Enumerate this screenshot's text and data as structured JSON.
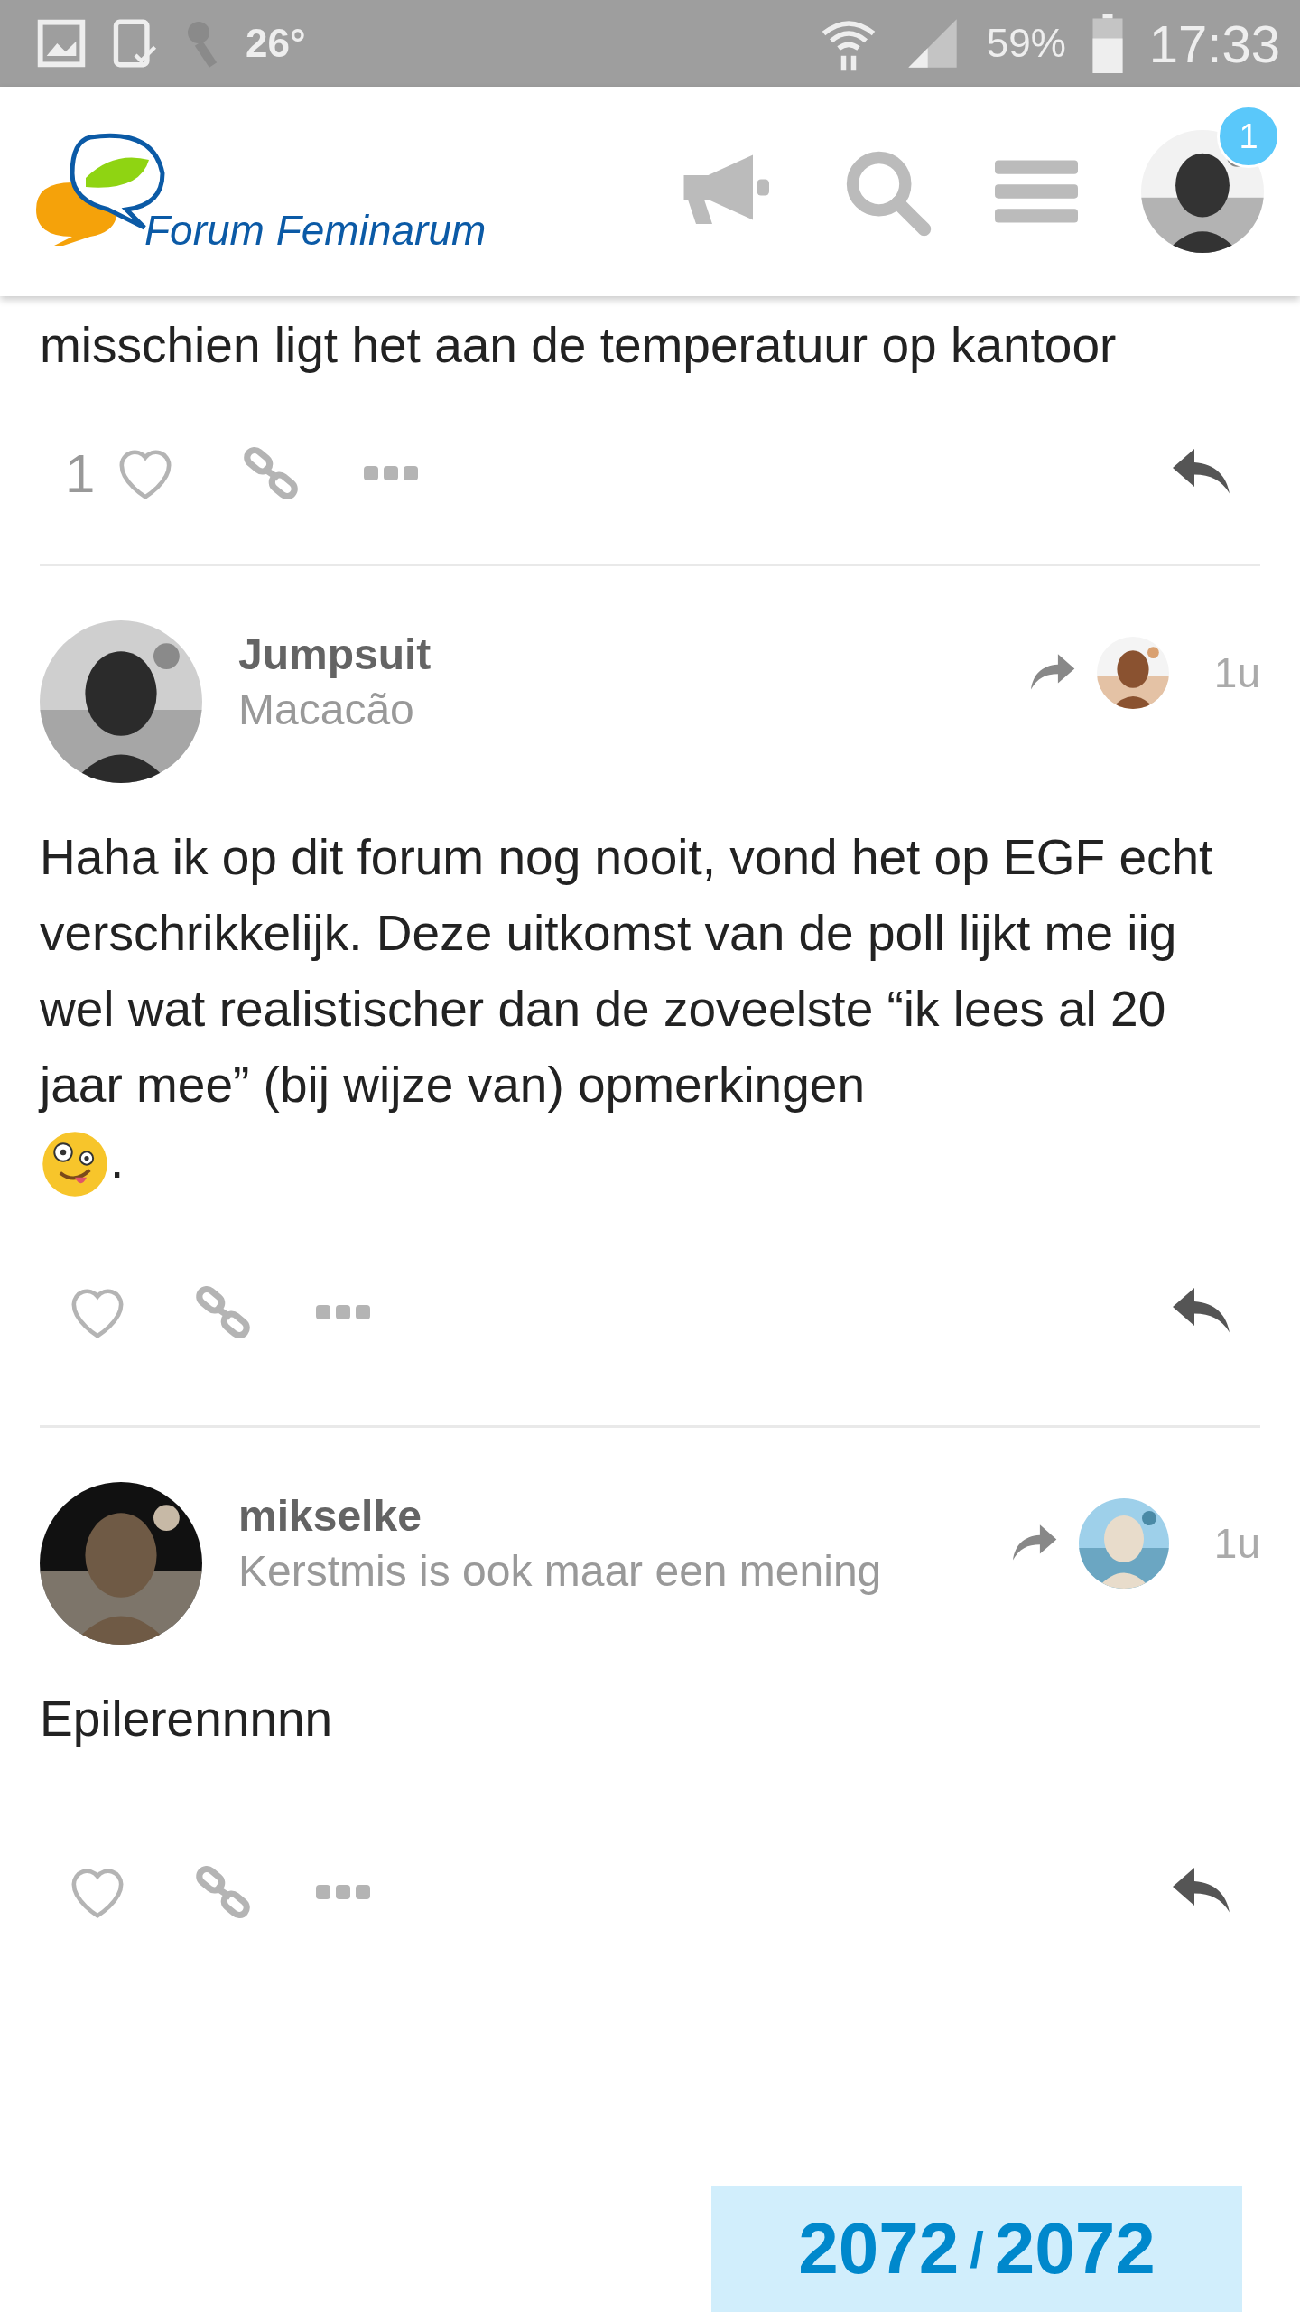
{
  "status_bar": {
    "temperature": "26°",
    "battery": "59%",
    "time": "17:33"
  },
  "header": {
    "logo_text": "Forum Feminarum",
    "notification_count": "1"
  },
  "posts": [
    {
      "kind": "partial",
      "body": "misschien ligt het aan de temperatuur op kantoor",
      "like_count": "1"
    },
    {
      "kind": "full",
      "username": "Jumpsuit",
      "title": "Macacão",
      "time": "1u",
      "body": "Haha ik op dit forum nog nooit, vond het op EGF echt verschrikkelijk. Deze uitkomst van de poll lijkt me iig wel wat realistischer dan de zoveelste “ik lees al 20 jaar mee” (bij wijze van) opmerkingen",
      "body_end": "."
    },
    {
      "kind": "full",
      "username": "mikselke",
      "title": "Kerstmis is ook maar een mening",
      "time": "1u",
      "body": "Epilerennnnn"
    }
  ],
  "progress": {
    "current": "2072",
    "separator": "/",
    "total": "2072"
  }
}
